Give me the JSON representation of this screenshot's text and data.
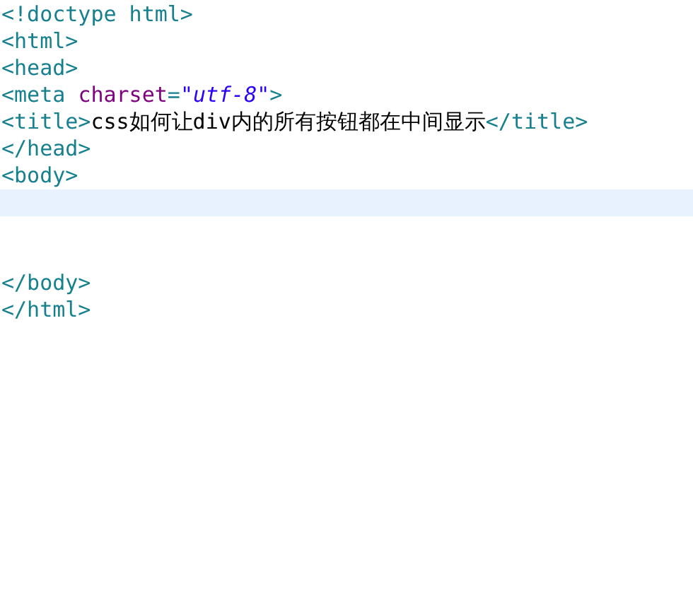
{
  "editor": {
    "lines": [
      {
        "kind": "code",
        "tokens": [
          {
            "kind": "tag",
            "text": "<!doctype html>"
          }
        ]
      },
      {
        "kind": "code",
        "tokens": [
          {
            "kind": "tag",
            "text": "<html>"
          }
        ]
      },
      {
        "kind": "code",
        "tokens": [
          {
            "kind": "tag",
            "text": "<head>"
          }
        ]
      },
      {
        "kind": "code",
        "tokens": [
          {
            "kind": "tag",
            "text": "<meta "
          },
          {
            "kind": "attr",
            "text": "charset"
          },
          {
            "kind": "tag",
            "text": "="
          },
          {
            "kind": "string",
            "text": "\"utf-8\""
          },
          {
            "kind": "tag",
            "text": ">"
          }
        ]
      },
      {
        "kind": "code",
        "tokens": [
          {
            "kind": "tag",
            "text": "<title>"
          },
          {
            "kind": "text",
            "text": "css如何让div内的所有按钮都在中间显示"
          },
          {
            "kind": "tag",
            "text": "</title>"
          }
        ]
      },
      {
        "kind": "code",
        "tokens": [
          {
            "kind": "tag",
            "text": "</head>"
          }
        ]
      },
      {
        "kind": "code",
        "tokens": [
          {
            "kind": "tag",
            "text": "<body>"
          }
        ]
      },
      {
        "kind": "current"
      },
      {
        "kind": "blank"
      },
      {
        "kind": "blank"
      },
      {
        "kind": "code",
        "tokens": [
          {
            "kind": "tag",
            "text": "</body>"
          }
        ]
      },
      {
        "kind": "code",
        "tokens": [
          {
            "kind": "tag",
            "text": "</html>"
          }
        ]
      }
    ]
  }
}
